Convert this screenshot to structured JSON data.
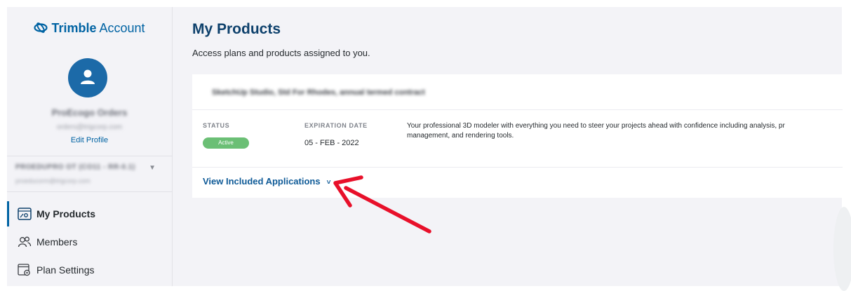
{
  "brand": {
    "name": "Trimble",
    "suffix": "Account"
  },
  "user": {
    "name": "ProEcogo Orders",
    "email": "orders@trigcorp.com",
    "edit_profile": "Edit Profile"
  },
  "account": {
    "name": "PROEDUPRO OT (CO11 - RR-0.1)",
    "sub": "proeducorm@trigcorp.com"
  },
  "nav": [
    {
      "label": "My Products",
      "icon": "products-icon",
      "active": true
    },
    {
      "label": "Members",
      "icon": "members-icon",
      "active": false
    },
    {
      "label": "Plan Settings",
      "icon": "plan-settings-icon",
      "active": false
    }
  ],
  "page": {
    "title": "My Products",
    "subtitle": "Access plans and products assigned to you."
  },
  "product": {
    "title": "SketchUp Studio, Std For Rhodes, annual termed contract",
    "status_label": "STATUS",
    "status": "Active",
    "expiration_label": "EXPIRATION DATE",
    "expiration": "05 - FEB - 2022",
    "description_line1": "Your professional 3D modeler with everything you need to steer your projects ahead with confidence including analysis, pr",
    "description_line2": "management, and rendering tools.",
    "view_link": "View Included Applications",
    "view_chevron": "˅"
  },
  "colors": {
    "brand": "#0063a3",
    "title": "#0e416c",
    "status_active": "#6bbf75",
    "annotation_arrow": "#e8102a",
    "sidebar_bg": "#f3f3f7"
  }
}
